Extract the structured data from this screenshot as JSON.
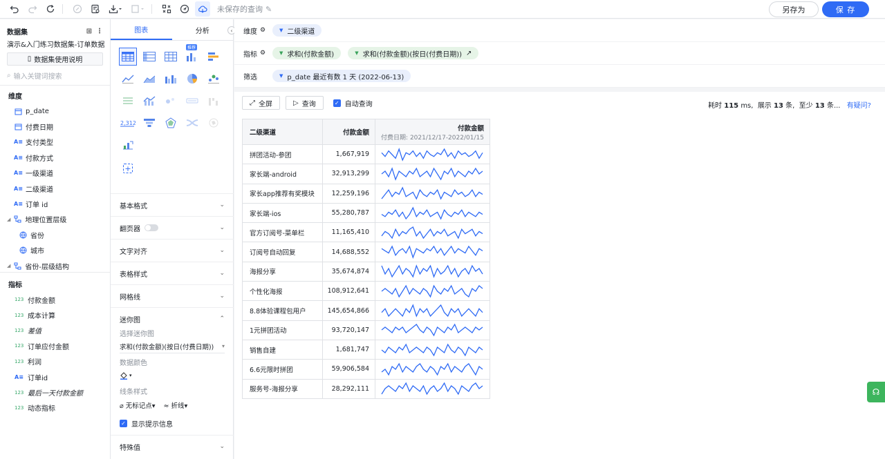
{
  "toolbar": {
    "title": "未保存的查询",
    "save_as_label": "另存为",
    "save_label": "保 存"
  },
  "left_panel": {
    "header": "数据集",
    "dataset_name": "演示&入门练习数据集-订单数据",
    "doc_button": "数据集使用说明",
    "search_placeholder": "输入关键词搜索",
    "dimensions_title": "维度",
    "dimensions": [
      {
        "label": "p_date",
        "icon": "date-icon"
      },
      {
        "label": "付费日期",
        "icon": "date-icon"
      },
      {
        "label": "支付类型",
        "icon": "text-icon"
      },
      {
        "label": "付款方式",
        "icon": "text-icon"
      },
      {
        "label": "一级渠道",
        "icon": "text-icon"
      },
      {
        "label": "二级渠道",
        "icon": "text-icon"
      },
      {
        "label": "订单 id",
        "icon": "text-icon"
      },
      {
        "label": "地理位置层级",
        "icon": "hierarchy-icon"
      },
      {
        "label": "省份",
        "icon": "globe-icon"
      },
      {
        "label": "城市",
        "icon": "globe-icon"
      },
      {
        "label": "省份-层级结构",
        "icon": "hierarchy-icon"
      }
    ],
    "metrics_title": "指标",
    "metrics": [
      {
        "label": "付款金额",
        "icon": "number-icon"
      },
      {
        "label": "成本计算",
        "icon": "number-icon"
      },
      {
        "label": "差值",
        "icon": "number-icon"
      },
      {
        "label": "订单应付金额",
        "icon": "number-icon"
      },
      {
        "label": "利润",
        "icon": "number-icon"
      },
      {
        "label": "订单id",
        "icon": "text-icon"
      },
      {
        "label": "最后一天付款金额",
        "icon": "number-icon"
      },
      {
        "label": "动态指标",
        "icon": "number-icon"
      }
    ]
  },
  "chart_panel": {
    "tab_chart": "图表",
    "tab_analysis": "分析",
    "recommend_badge": "推荐",
    "sections": {
      "basic_format": "基本格式",
      "pager": "翻页器",
      "text_align": "文字对齐",
      "table_style": "表格样式",
      "grid_lines": "网格线",
      "mini_chart": "迷你图",
      "special_values": "特殊值"
    },
    "mini": {
      "select_label": "选择迷你图",
      "select_value": "求和(付款金额)(按日(付费日期))",
      "color_label": "数据颜色",
      "line_style_label": "线条样式",
      "marker_option": "无标记点",
      "line_option": "折线",
      "show_tooltip": "显示提示信息"
    }
  },
  "filters": {
    "dimension_label": "维度",
    "dimension_pill": "二级渠道",
    "metric_label": "指标",
    "metric_pills": [
      "求和(付款金额)",
      "求和(付款金额)(按日(付费日期))"
    ],
    "filter_label": "筛选",
    "filter_pill": "p_date 最近有数 1 天 (2022-06-13)"
  },
  "query_bar": {
    "fullscreen": "全屏",
    "query": "查询",
    "auto_query": "自动查询",
    "stats_prefix": "耗时",
    "stats_time": "115",
    "stats_ms": "ms,",
    "stats_show": "展示",
    "stats_count": "13",
    "stats_rows": "条,",
    "stats_least": "至少",
    "stats_least_count": "13",
    "stats_least_rows": "条...",
    "stats_help": "有疑问?"
  },
  "table": {
    "headers": [
      "二级渠道",
      "付款金额",
      "付款金额"
    ],
    "sub_header": "付费日期: 2021/12/17-2022/01/15",
    "rows": [
      {
        "channel": "拼团活动-参团",
        "amount": "1,667,919",
        "spark": [
          6,
          4,
          7,
          5,
          3,
          8,
          2,
          6,
          5,
          7,
          4,
          6,
          3,
          7,
          5,
          4,
          6,
          5,
          8,
          4,
          6,
          3,
          7,
          5,
          6,
          4,
          5,
          7,
          3,
          6
        ]
      },
      {
        "channel": "家长端-android",
        "amount": "32,913,299",
        "spark": [
          5,
          6,
          4,
          7,
          3,
          6,
          5,
          4,
          6,
          5,
          7,
          4,
          5,
          6,
          4,
          7,
          5,
          3,
          6,
          5,
          7,
          4,
          6,
          5,
          4,
          6,
          5,
          7,
          5,
          6
        ]
      },
      {
        "channel": "家长app推荐有奖模块",
        "amount": "12,259,196",
        "spark": [
          3,
          5,
          7,
          4,
          6,
          5,
          8,
          4,
          5,
          6,
          3,
          7,
          5,
          4,
          6,
          5,
          7,
          3,
          6,
          5,
          4,
          7,
          5,
          6,
          4,
          5,
          7,
          4,
          6,
          5
        ]
      },
      {
        "channel": "家长端-ios",
        "amount": "55,280,787",
        "spark": [
          5,
          4,
          6,
          5,
          7,
          4,
          6,
          3,
          5,
          8,
          4,
          6,
          5,
          7,
          4,
          5,
          6,
          3,
          7,
          5,
          4,
          6,
          5,
          7,
          4,
          6,
          5,
          4,
          6,
          5
        ]
      },
      {
        "channel": "官方订阅号-菜单栏",
        "amount": "11,165,410",
        "spark": [
          4,
          6,
          5,
          3,
          7,
          4,
          6,
          5,
          7,
          8,
          4,
          6,
          3,
          5,
          7,
          4,
          6,
          5,
          7,
          4,
          5,
          6,
          3,
          7,
          5,
          6,
          7,
          4,
          6,
          5
        ]
      },
      {
        "channel": "订阅号自动回复",
        "amount": "14,688,552",
        "spark": [
          6,
          5,
          4,
          7,
          3,
          5,
          6,
          4,
          7,
          2,
          6,
          5,
          4,
          6,
          5,
          7,
          4,
          6,
          3,
          5,
          7,
          4,
          6,
          5,
          4,
          7,
          5,
          3,
          6,
          5
        ]
      },
      {
        "channel": "海报分享",
        "amount": "35,674,874",
        "spark": [
          7,
          4,
          6,
          3,
          5,
          7,
          4,
          6,
          5,
          3,
          7,
          4,
          6,
          5,
          7,
          3,
          6,
          4,
          5,
          7,
          4,
          6,
          3,
          5,
          6,
          4,
          7,
          5,
          6,
          4
        ]
      },
      {
        "channel": "个性化海报",
        "amount": "108,912,641",
        "spark": [
          5,
          6,
          5,
          4,
          6,
          3,
          5,
          7,
          4,
          6,
          5,
          4,
          6,
          5,
          3,
          7,
          5,
          4,
          6,
          5,
          7,
          4,
          5,
          6,
          4,
          3,
          6,
          5,
          7,
          6
        ]
      },
      {
        "channel": "8.8体验课程包用户",
        "amount": "145,654,866",
        "spark": [
          5,
          6,
          4,
          5,
          6,
          5,
          4,
          6,
          5,
          7,
          4,
          6,
          5,
          6,
          4,
          5,
          6,
          7,
          5,
          4,
          6,
          5,
          6,
          4,
          5,
          6,
          5,
          4,
          6,
          5
        ]
      },
      {
        "channel": "1元拼团活动",
        "amount": "93,720,147",
        "spark": [
          5,
          6,
          5,
          4,
          6,
          5,
          6,
          4,
          5,
          6,
          7,
          5,
          4,
          6,
          5,
          3,
          6,
          5,
          4,
          6,
          5,
          7,
          4,
          5,
          6,
          5,
          4,
          6,
          5,
          6
        ]
      },
      {
        "channel": "销售自建",
        "amount": "1,681,747",
        "spark": [
          5,
          4,
          6,
          5,
          4,
          6,
          5,
          7,
          4,
          5,
          6,
          5,
          4,
          6,
          5,
          3,
          6,
          5,
          4,
          7,
          5,
          4,
          6,
          5,
          3,
          6,
          5,
          4,
          6,
          5
        ]
      },
      {
        "channel": "6.6元限时拼团",
        "amount": "59,906,584",
        "spark": [
          4,
          5,
          3,
          6,
          5,
          7,
          4,
          6,
          5,
          4,
          6,
          7,
          5,
          4,
          6,
          5,
          3,
          6,
          5,
          7,
          4,
          6,
          5,
          4,
          6,
          7,
          5,
          3,
          6,
          5
        ]
      },
      {
        "channel": "服务号-海报分享",
        "amount": "28,292,111",
        "spark": [
          3,
          5,
          6,
          5,
          4,
          6,
          5,
          7,
          4,
          6,
          5,
          4,
          6,
          3,
          5,
          6,
          4,
          5,
          7,
          4,
          6,
          5,
          3,
          6,
          5,
          4,
          6,
          7,
          5,
          6
        ]
      }
    ]
  },
  "colors": {
    "accent": "#2f6bf5",
    "sparkline": "#2f6bf5"
  }
}
